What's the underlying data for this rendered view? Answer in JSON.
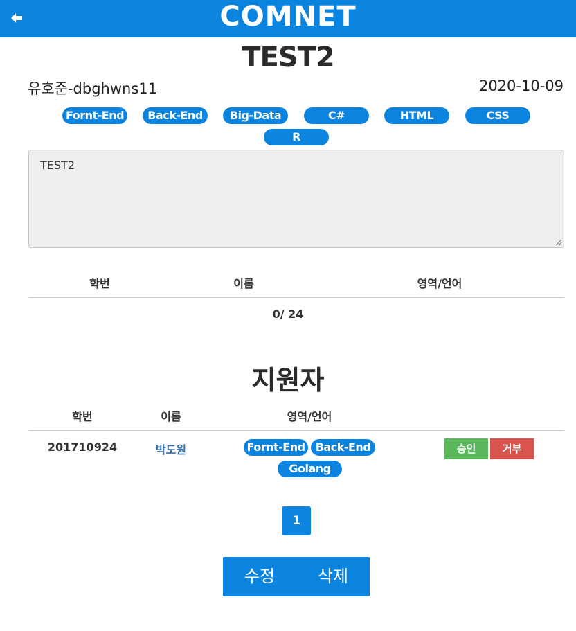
{
  "header": {
    "logo": "COMNET",
    "back_icon": "arrow-left-icon"
  },
  "post": {
    "title": "TEST2",
    "author": "유호준-dbghwns11",
    "date": "2020-10-09",
    "tags": [
      "Fornt-End",
      "Back-End",
      "Big-Data",
      "C#",
      "HTML",
      "CSS",
      "R"
    ],
    "content": "TEST2"
  },
  "members_table": {
    "headers": [
      "학번",
      "이름",
      "영역/언어"
    ],
    "count_text": "0/ 24"
  },
  "applicants": {
    "title": "지원자",
    "headers": [
      "학번",
      "이름",
      "영역/언어"
    ],
    "rows": [
      {
        "student_id": "201710924",
        "name": "박도원",
        "tags": [
          "Fornt-End",
          "Back-End",
          "Golang"
        ],
        "approve_label": "승인",
        "reject_label": "거부"
      }
    ]
  },
  "pagination": {
    "current": "1"
  },
  "actions": {
    "edit_label": "수정",
    "delete_label": "삭제"
  },
  "colors": {
    "primary": "#0a84df",
    "approve": "#5cb85c",
    "reject": "#d9534f",
    "link": "#336fb0"
  }
}
